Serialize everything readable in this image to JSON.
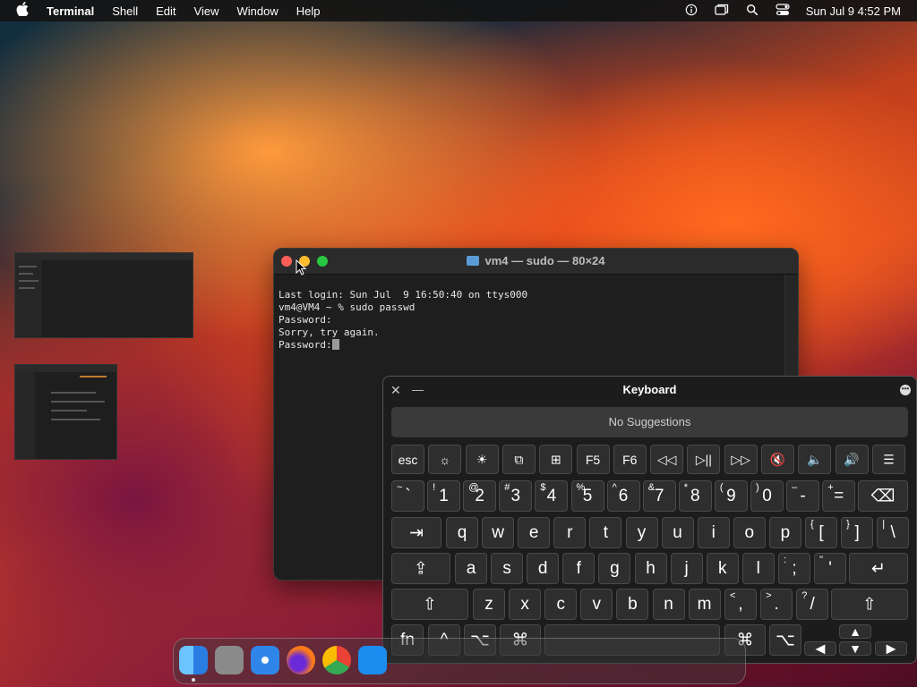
{
  "menubar": {
    "apple_label": "",
    "app_name": "Terminal",
    "menus": [
      "Shell",
      "Edit",
      "View",
      "Window",
      "Help"
    ],
    "clock": "Sun Jul 9  4:52 PM"
  },
  "terminal": {
    "title": "vm4 — sudo — 80×24",
    "lines": [
      "Last login: Sun Jul  9 16:50:40 on ttys000",
      "vm4@VM4 ~ % sudo passwd",
      "Password:",
      "Sorry, try again.",
      "Password:"
    ]
  },
  "keyboard": {
    "title": "Keyboard",
    "close_glyph": "✕",
    "minimize_glyph": "—",
    "suggestions": "No Suggestions",
    "fn_row": [
      "esc",
      "☼",
      "☀",
      "⧉",
      "⊞",
      "F5",
      "F6",
      "◁◁",
      "▷||",
      "▷▷",
      "🔇",
      "🔈",
      "🔊",
      "☰"
    ],
    "number_row": [
      {
        "s": "~",
        "m": "`"
      },
      {
        "s": "!",
        "m": "1"
      },
      {
        "s": "@",
        "m": "2"
      },
      {
        "s": "#",
        "m": "3"
      },
      {
        "s": "$",
        "m": "4"
      },
      {
        "s": "%",
        "m": "5"
      },
      {
        "s": "^",
        "m": "6"
      },
      {
        "s": "&",
        "m": "7"
      },
      {
        "s": "*",
        "m": "8"
      },
      {
        "s": "(",
        "m": "9"
      },
      {
        "s": ")",
        "m": "0"
      },
      {
        "s": "–",
        "m": "-"
      },
      {
        "s": "+",
        "m": "="
      }
    ],
    "delete": "⌫",
    "tab": "⇥",
    "row_q": [
      "q",
      "w",
      "e",
      "r",
      "t",
      "y",
      "u",
      "i",
      "o",
      "p"
    ],
    "row_q_extra": [
      {
        "s": "{",
        "m": "["
      },
      {
        "s": "}",
        "m": "]"
      },
      {
        "s": "|",
        "m": "\\"
      }
    ],
    "caps": "⇪",
    "row_a": [
      "a",
      "s",
      "d",
      "f",
      "g",
      "h",
      "j",
      "k",
      "l"
    ],
    "row_a_extra": [
      {
        "s": ":",
        "m": ";"
      },
      {
        "s": "\"",
        "m": "'"
      }
    ],
    "return": "↵",
    "shift": "⇧",
    "row_z": [
      "z",
      "x",
      "c",
      "v",
      "b",
      "n",
      "m"
    ],
    "row_z_extra": [
      {
        "s": "<",
        "m": ","
      },
      {
        "s": ">",
        "m": "."
      },
      {
        "s": "?",
        "m": "/"
      }
    ],
    "bottom": {
      "fn": "fn",
      "ctrl": "^",
      "option": "⌥",
      "command": "⌘"
    },
    "arrows": {
      "up": "▲",
      "down": "▼",
      "left": "◀",
      "right": "▶"
    }
  },
  "dock": {
    "apps": [
      "finder-icon",
      "launchpad-icon",
      "safari-icon",
      "firefox-icon",
      "chrome-icon",
      "app-store-icon"
    ],
    "colors": [
      "#3b8ee8",
      "#8f8f8f",
      "#2f86e8",
      "#ff7a1a",
      "#e8e8e8",
      "#1b8cf0"
    ]
  }
}
